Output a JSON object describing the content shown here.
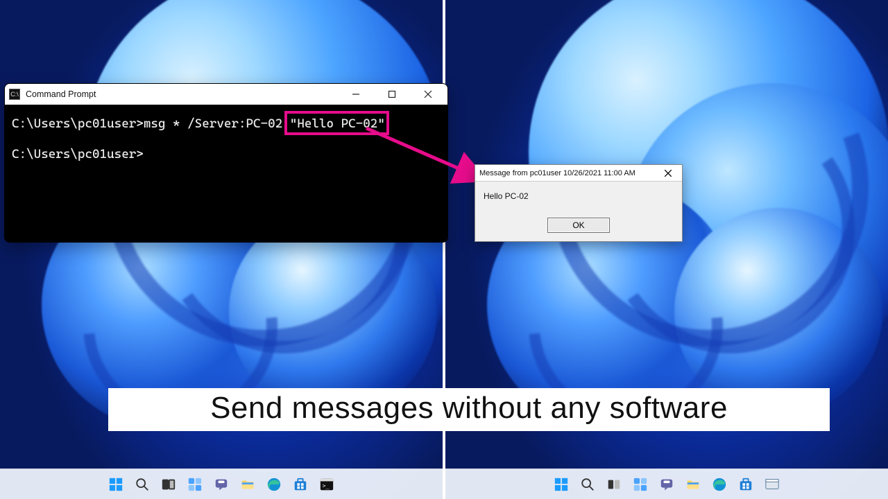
{
  "cmd": {
    "title": "Command Prompt",
    "line1_prompt": "C:\\Users\\pc01user>",
    "line1_cmd_before": "msg * /Server:PC-02 ",
    "line1_cmd_hl": "\"Hello PC-02\"",
    "line2_prompt": "C:\\Users\\pc01user>",
    "icon_txt": "C:\\"
  },
  "popup": {
    "title": "Message from pc01user 10/26/2021 11:00 AM",
    "body": "Hello PC-02",
    "ok": "OK"
  },
  "caption": "Send messages without any software",
  "taskbar": {
    "items": [
      "start",
      "search",
      "taskview",
      "widgets",
      "chat",
      "explorer",
      "edge",
      "store",
      "terminal"
    ]
  },
  "colors": {
    "hl": "#e60c8b"
  }
}
